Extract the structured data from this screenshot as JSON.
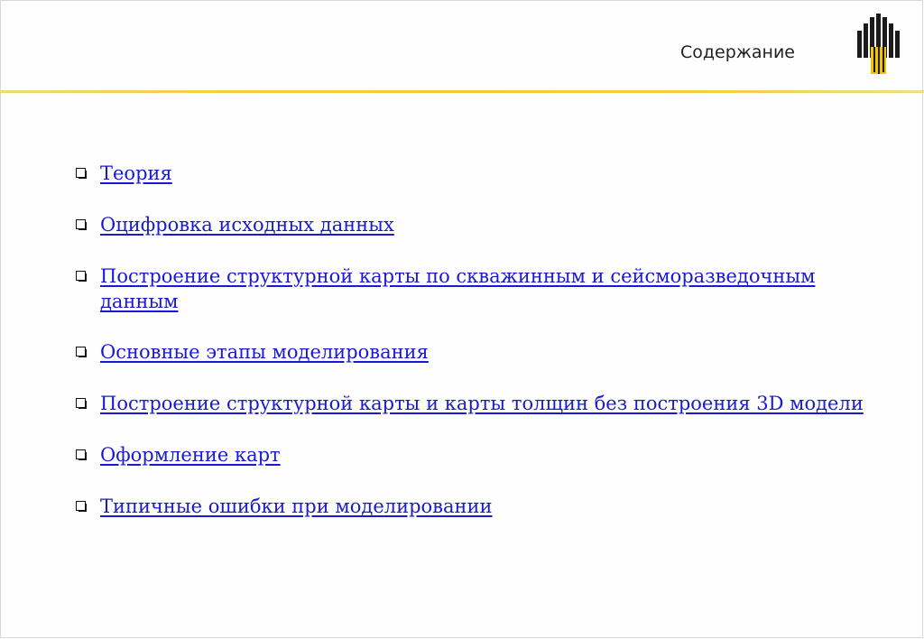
{
  "header": {
    "title": "Содержание"
  },
  "colors": {
    "accent": "#efcc3c",
    "link": "#1a1ad1",
    "logo_dark": "#1b1b1b",
    "logo_yellow": "#f2c500"
  },
  "toc": {
    "items": [
      {
        "label": "Теория"
      },
      {
        "label": "Оцифровка исходных данных"
      },
      {
        "label": "Построение структурной карты по скважинным и сейсморазведочным данным"
      },
      {
        "label": "Основные этапы моделирования"
      },
      {
        "label": "Построение структурной карты и карты толщин без построения 3D модели"
      },
      {
        "label": "Оформление карт"
      },
      {
        "label": "Типичные ошибки при моделировании"
      }
    ]
  }
}
